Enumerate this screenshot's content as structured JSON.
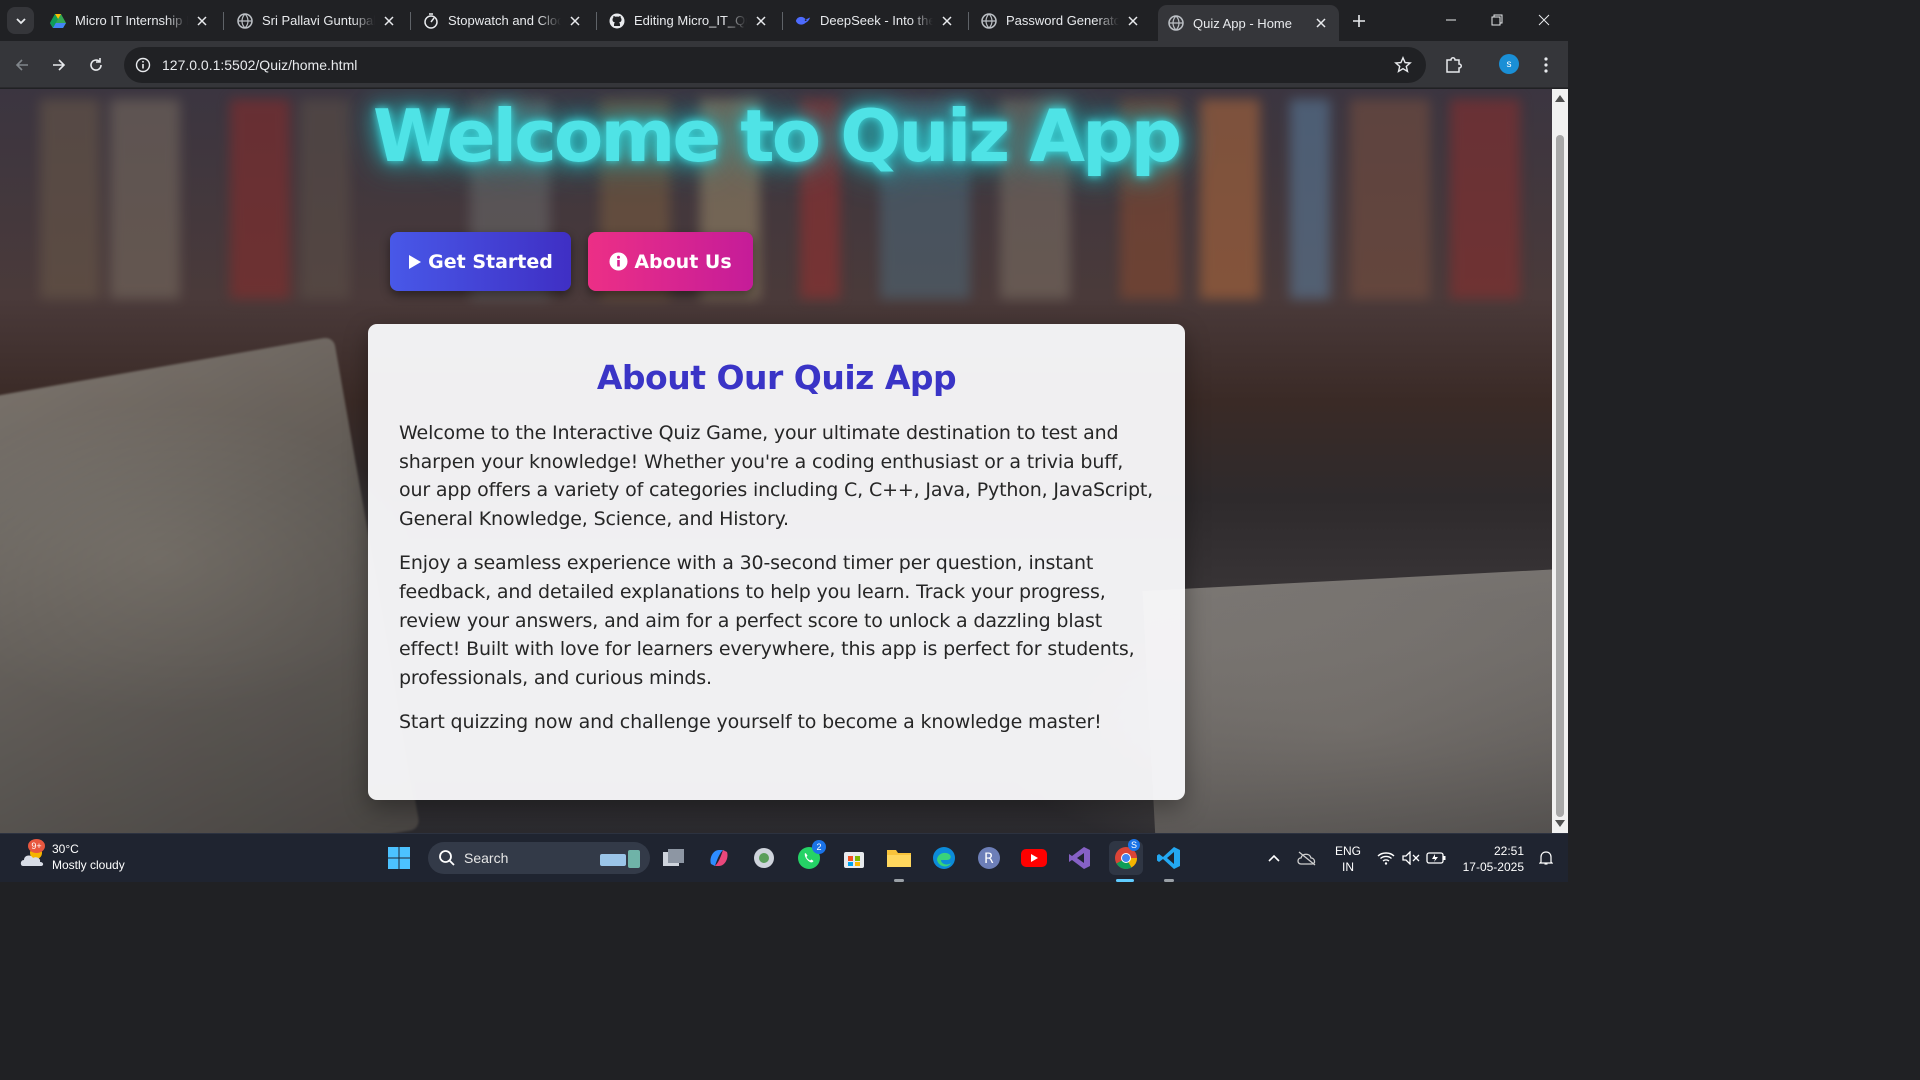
{
  "browser": {
    "tabs": [
      {
        "title": "Micro IT Internship Program",
        "icon": "google-drive-icon",
        "active": false
      },
      {
        "title": "Sri Pallavi Guntupalli",
        "icon": "globe-icon",
        "active": false
      },
      {
        "title": "Stopwatch and Clock",
        "icon": "stopwatch-icon",
        "active": false
      },
      {
        "title": "Editing Micro_IT_Quiz",
        "icon": "github-icon",
        "active": false
      },
      {
        "title": "DeepSeek - Into the Unknown",
        "icon": "deepseek-icon",
        "active": false
      },
      {
        "title": "Password Generator",
        "icon": "globe-icon",
        "active": false
      },
      {
        "title": "Quiz App - Home",
        "icon": "globe-icon",
        "active": true
      }
    ],
    "url": "127.0.0.1:5502/Quiz/home.html",
    "profile_initial": "s"
  },
  "page": {
    "hero_title": "Welcome to Quiz App",
    "buttons": {
      "get_started": "Get Started",
      "about_us": "About Us"
    },
    "about": {
      "heading": "About Our Quiz App",
      "paragraphs": [
        "Welcome to the Interactive Quiz Game, your ultimate destination to test and sharpen your knowledge! Whether you're a coding enthusiast or a trivia buff, our app offers a variety of categories including C, C++, Java, Python, JavaScript, General Knowledge, Science, and History.",
        "Enjoy a seamless experience with a 30-second timer per question, instant feedback, and detailed explanations to help you learn. Track your progress, review your answers, and aim for a perfect score to unlock a dazzling blast effect! Built with love for learners everywhere, this app is perfect for students, professionals, and curious minds.",
        "Start quizzing now and challenge yourself to become a knowledge master!"
      ]
    },
    "colors": {
      "title_glow": "#4fe3e6",
      "get_started": "#4858e8",
      "about_us": "#ec2f86",
      "heading": "#3a34c6"
    }
  },
  "taskbar": {
    "weather": {
      "temp": "30°C",
      "condition": "Mostly cloudy",
      "badge": "9+"
    },
    "search_label": "Search",
    "whatsapp_badge": "2",
    "chrome_badge": "S",
    "language": {
      "line1": "ENG",
      "line2": "IN"
    },
    "clock": {
      "time": "22:51",
      "date": "17-05-2025"
    }
  }
}
